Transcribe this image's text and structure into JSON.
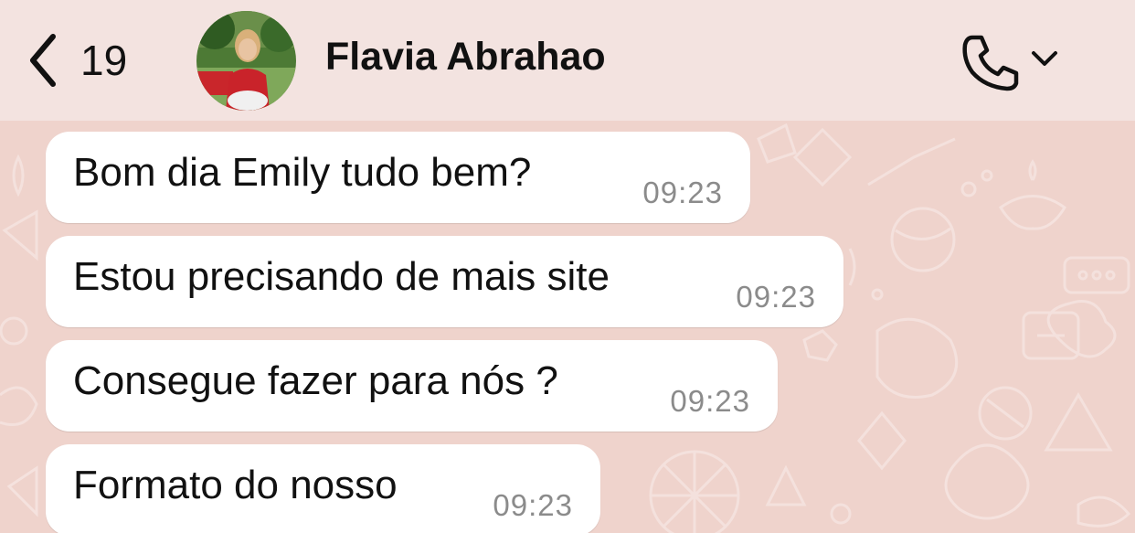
{
  "header": {
    "back_count": "19",
    "contact_name": "Flavia Abrahao",
    "icons": {
      "back": "chevron-left-icon",
      "call": "phone-icon",
      "call_menu": "chevron-down-icon"
    }
  },
  "messages": [
    {
      "text": "Bom dia Emily tudo bem?",
      "time": "09:23"
    },
    {
      "text": "Estou precisando de mais site",
      "time": "09:23"
    },
    {
      "text": "Consegue fazer para nós ?",
      "time": "09:23"
    },
    {
      "text": "Formato do nosso",
      "time": "09:23"
    }
  ],
  "colors": {
    "header_bg": "#f3e3e0",
    "chat_bg": "#efd3cc",
    "bubble_bg": "#ffffff",
    "timestamp": "#8b8b8b"
  }
}
